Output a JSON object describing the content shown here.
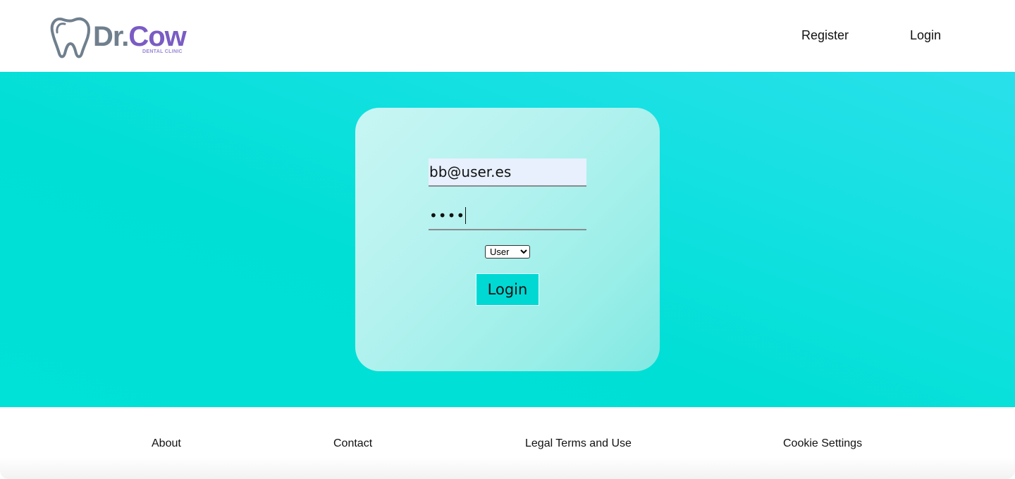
{
  "header": {
    "logo": {
      "brand_prefix": "Dr.",
      "brand_name": "Cow",
      "tagline": "DENTAL CLINIC",
      "icon": "tooth-icon"
    },
    "nav": {
      "register_label": "Register",
      "login_label": "Login"
    }
  },
  "login_form": {
    "email_value": "bb@user.es",
    "password_masked": "••••",
    "role_options": [
      "User"
    ],
    "role_selected": "User",
    "submit_label": "Login"
  },
  "footer": {
    "links": [
      "About",
      "Contact",
      "Legal Terms and Use",
      "Cookie Settings"
    ]
  },
  "colors": {
    "hero_background": "#00dfd5",
    "button_background": "#00d8d4",
    "email_autofill_background": "#e8f0fe",
    "brand_purple": "#7a5cc4",
    "brand_gray": "#6f7f8e"
  }
}
